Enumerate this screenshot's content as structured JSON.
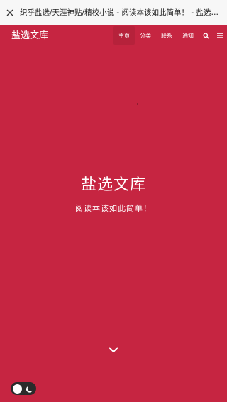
{
  "browser": {
    "title": "织乎盐选/天涯神贴/精校小说 - 阅读本该如此简单！ - 盐选文库",
    "close_icon": "close-icon"
  },
  "header": {
    "brand": "盐选文库",
    "nav": [
      {
        "label": "主页",
        "active": true
      },
      {
        "label": "分类",
        "active": false
      },
      {
        "label": "联系",
        "active": false
      },
      {
        "label": "通知",
        "active": false
      }
    ],
    "icons": [
      "search-icon",
      "menu-icon"
    ]
  },
  "hero": {
    "title": "盐选文库",
    "subtitle": "阅读本该如此简单！",
    "scroll_icon": "chevron-down-icon"
  },
  "theme_toggle": {
    "icon": "moon-icon"
  },
  "colors": {
    "background": "#c62541",
    "text": "#ffffff",
    "toggle": "#2b2b2b"
  }
}
